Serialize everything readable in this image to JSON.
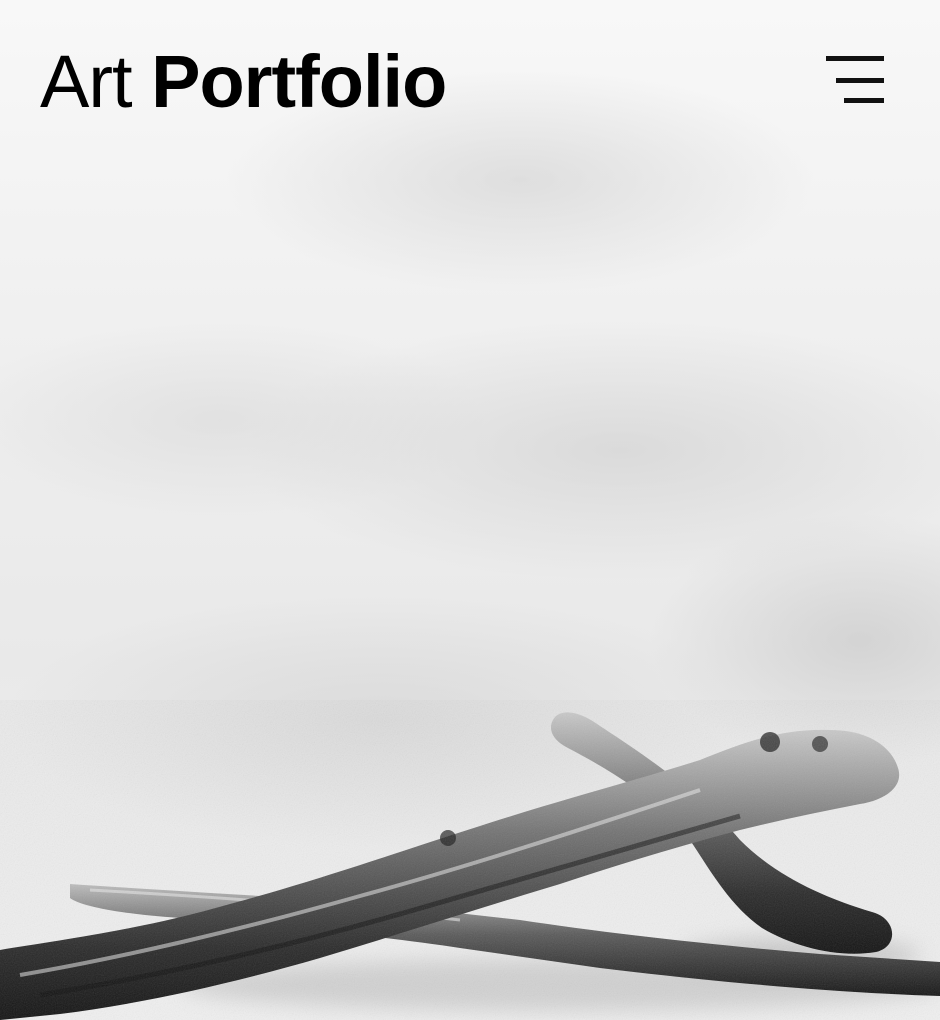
{
  "header": {
    "logo_light": "Art",
    "logo_bold": "Portfolio",
    "menu_icon": "hamburger-menu-icon"
  },
  "hero": {
    "subject": "driftwood-photo",
    "style": "black-and-white"
  },
  "colors": {
    "text": "#000000",
    "background": "#f0f0f0"
  }
}
